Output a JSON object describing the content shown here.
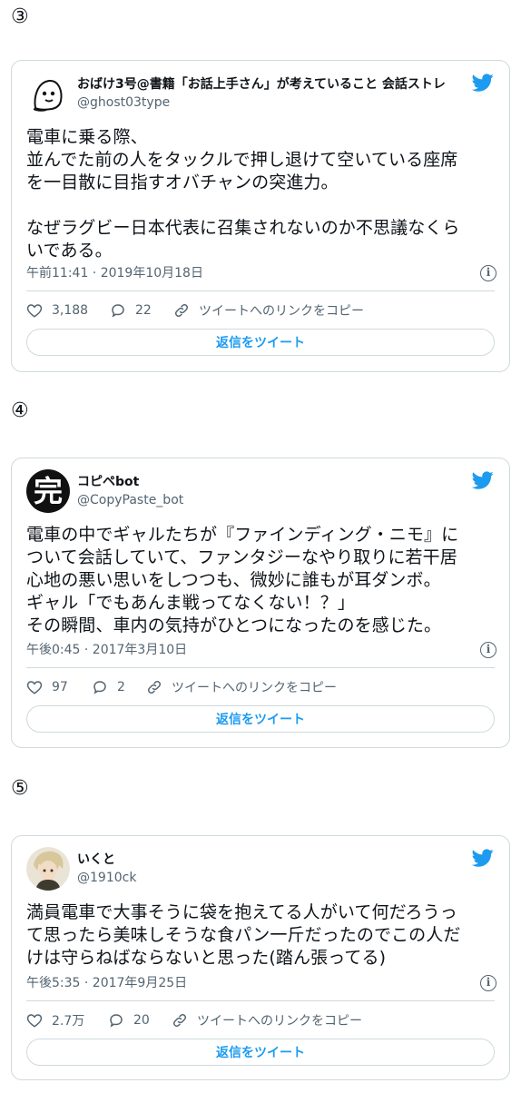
{
  "accent_color": "#1d9bf0",
  "tweets": [
    {
      "number": "③",
      "display_name": "おばけ3号@書籍「お話上手さん」が考えていること 会話ストレ",
      "handle": "@ghost03type",
      "text": "電車に乗る際、\n並んでた前の人をタックルで押し退けて空いている座席\nを一目散に目指すオバチャンの突進力。\n\nなぜラグビー日本代表に召集されないのか不思議なくら\nいである。",
      "timestamp": "午前11:41 · 2019年10月18日",
      "likes": "3,188",
      "replies": "22",
      "copy_link": "ツイートへのリンクをコピー",
      "reply_button": "返信をツイート",
      "avatar": "ghost-avatar"
    },
    {
      "number": "④",
      "display_name": "コピペbot",
      "handle": "@CopyPaste_bot",
      "text": "電車の中でギャルたちが『ファインディング・ニモ』に\nついて会話していて、ファンタジーなやり取りに若干居\n心地の悪い思いをしつつも、微妙に誰もが耳ダンボ。\nギャル「でもあんま戦ってなくない！？」\nその瞬間、車内の気持がひとつになったのを感じた。",
      "timestamp": "午後0:45 · 2017年3月10日",
      "likes": "97",
      "replies": "2",
      "copy_link": "ツイートへのリンクをコピー",
      "reply_button": "返信をツイート",
      "avatar_char": "完"
    },
    {
      "number": "⑤",
      "display_name": "いくと",
      "handle": "@1910ck",
      "text": "満員電車で大事そうに袋を抱えてる人がいて何だろうっ\nて思ったら美味しそうな食パン一斤だったのでこの人だ\nけは守らねばならないと思った(踏ん張ってる)",
      "timestamp": "午後5:35 · 2017年9月25日",
      "likes": "2.7万",
      "replies": "20",
      "copy_link": "ツイートへのリンクをコピー",
      "reply_button": "返信をツイート",
      "avatar": "anime-character-avatar"
    }
  ]
}
